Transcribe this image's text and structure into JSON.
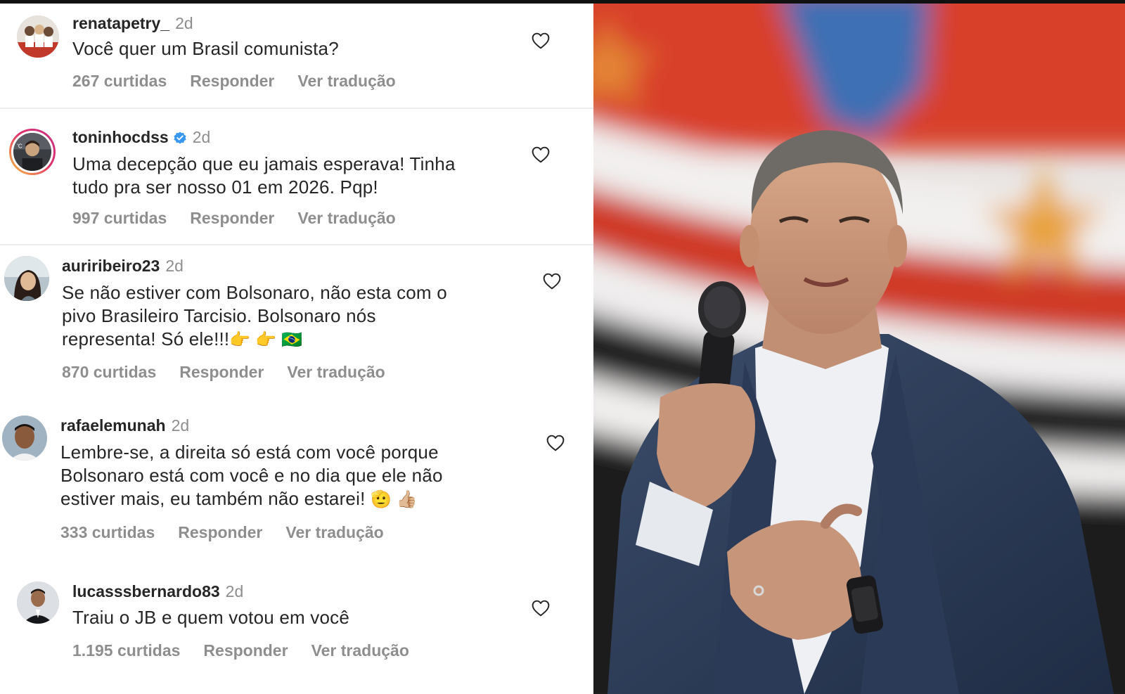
{
  "comments": [
    {
      "username": "renatapetry_",
      "time": "2d",
      "lines": [
        "Você  quer um Brasil comunista?"
      ],
      "likes": "267 curtidas",
      "reply": "Responder",
      "translate": "Ver tradução"
    },
    {
      "username": "toninhocdss",
      "time": "2d",
      "verified": true,
      "lines": [
        "Uma decepção que eu jamais esperava! Tinha",
        "tudo pra ser nosso 01 em 2026. Pqp!"
      ],
      "likes": "997 curtidas",
      "reply": "Responder",
      "translate": "Ver tradução"
    },
    {
      "username": "auriribeiro23",
      "time": "2d",
      "lines": [
        "Se não  estiver  com Bolsonaro,  não  esta com o",
        "pivo Brasileiro  Tarcisio.  Bolsonaro  nós",
        "representa! Só  ele!!!"
      ],
      "emoji": "👉 👉 🇧🇷",
      "likes": "870 curtidas",
      "reply": "Responder",
      "translate": "Ver tradução"
    },
    {
      "username": "rafaelemunah",
      "time": "2d",
      "lines": [
        "Lembre-se, a direita só está com você porque",
        "Bolsonaro está com você e no dia que ele não",
        "estiver mais, eu também não estarei!"
      ],
      "emoji": "🫡 👍🏼",
      "likes": "333 curtidas",
      "reply": "Responder",
      "translate": "Ver tradução"
    },
    {
      "username": "lucasssbernardo83",
      "time": "2d",
      "lines": [
        "Traiu o JB e quem votou em você"
      ],
      "likes": "1.195 curtidas",
      "reply": "Responder",
      "translate": "Ver tradução"
    }
  ],
  "colors": {
    "username": "#262626",
    "meta": "#8e8e8e",
    "verified": "#3897f0"
  },
  "icons": {
    "like": "heart-outline-icon",
    "verified": "verified-badge-icon"
  }
}
